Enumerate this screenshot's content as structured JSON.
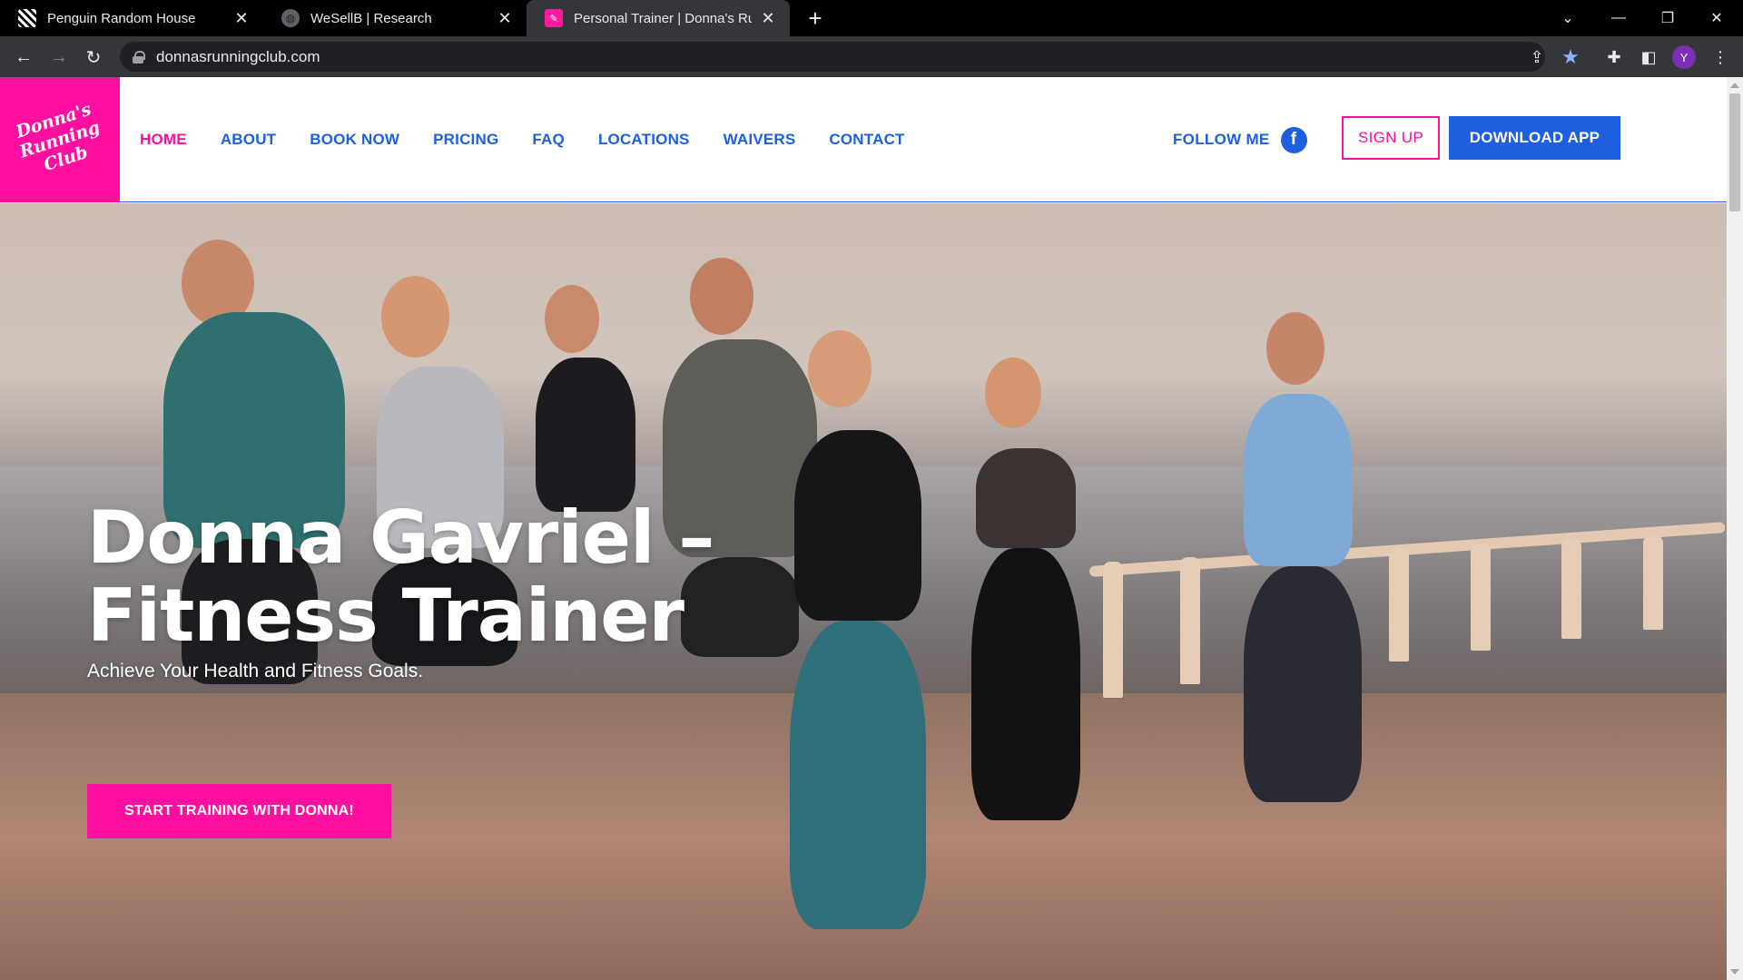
{
  "browser": {
    "tabs": [
      {
        "title": "Penguin Random House",
        "active": false
      },
      {
        "title": "WeSellB | Research",
        "active": false
      },
      {
        "title": "Personal Trainer | Donna's Runnin",
        "active": true
      }
    ],
    "url": "donnasrunningclub.com",
    "profile_initial": "Y"
  },
  "site": {
    "logo": {
      "line1": "Donna's",
      "line2": "Running",
      "line3": "Club"
    },
    "nav": [
      "HOME",
      "ABOUT",
      "BOOK NOW",
      "PRICING",
      "FAQ",
      "LOCATIONS",
      "WAIVERS",
      "CONTACT"
    ],
    "follow_label": "FOLLOW ME",
    "facebook_glyph": "f",
    "signup_label": "SIGN UP",
    "download_label": "DOWNLOAD APP",
    "colors": {
      "pink": "#ff0fa0",
      "blue": "#1e5fe0"
    }
  },
  "hero": {
    "title_line1": "Donna Gavriel –",
    "title_line2": "Fitness Trainer",
    "subtitle": "Achieve Your Health and Fitness Goals.",
    "cta": "START TRAINING WITH DONNA!"
  }
}
